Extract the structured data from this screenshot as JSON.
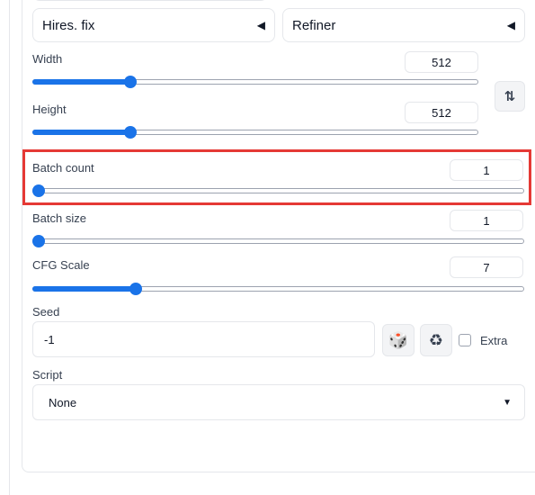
{
  "accordions": {
    "hires_fix": {
      "label": "Hires. fix",
      "icon": "triangle-left-icon",
      "glyph": "◀"
    },
    "refiner": {
      "label": "Refiner",
      "icon": "triangle-left-icon",
      "glyph": "◀"
    }
  },
  "width": {
    "label": "Width",
    "value": "512",
    "fraction": 0.22
  },
  "height": {
    "label": "Height",
    "value": "512",
    "fraction": 0.22
  },
  "swap_button": {
    "icon": "swap-vertical-arrows-icon",
    "glyph": "⇅"
  },
  "batch_count": {
    "label": "Batch count",
    "value": "1",
    "fraction": 0.0
  },
  "batch_size": {
    "label": "Batch size",
    "value": "1",
    "fraction": 0.0
  },
  "cfg_scale": {
    "label": "CFG Scale",
    "value": "7",
    "fraction": 0.21
  },
  "seed": {
    "label": "Seed",
    "value": "-1",
    "dice_icon": "dice-icon",
    "dice_glyph": "🎲",
    "recycle_icon": "recycle-icon",
    "recycle_glyph": "♻",
    "extra_label": "Extra",
    "extra_checked": false
  },
  "script": {
    "label": "Script",
    "selected": "None",
    "caret_glyph": "▼"
  },
  "colors": {
    "accent": "#1a73e8",
    "highlight": "#e53935"
  }
}
